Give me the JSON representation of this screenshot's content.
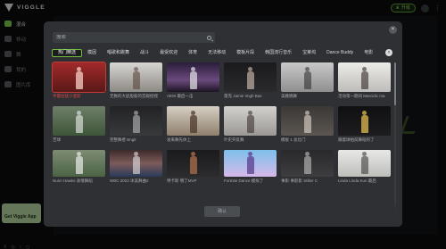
{
  "app": {
    "brand": "VIGGLE"
  },
  "topbar": {
    "upgrade_label": "升级",
    "icons": [
      "crown-icon",
      "avatar",
      "menu-icon"
    ]
  },
  "sidebar": {
    "items": [
      {
        "label": "混合",
        "icon": "mix-icon",
        "active": true
      },
      {
        "label": "移动",
        "icon": "move-icon",
        "active": false
      },
      {
        "label": "舞",
        "icon": "dance-icon",
        "active": false
      },
      {
        "label": "我的",
        "icon": "user-icon",
        "active": false
      },
      {
        "label": "图片库",
        "icon": "library-icon",
        "active": false
      }
    ],
    "get_app": "Get Viggle App",
    "socials": [
      "X",
      "Discord",
      "TikTok",
      "Instagram"
    ]
  },
  "modal": {
    "search_placeholder": "搜索",
    "tabs": [
      {
        "label": "热门精选",
        "active": true
      },
      {
        "label": "模因",
        "active": false
      },
      {
        "label": "唱歌和跳舞",
        "active": false
      },
      {
        "label": "战斗",
        "active": false
      },
      {
        "label": "最受欢迎",
        "active": false
      },
      {
        "label": "体育",
        "active": false
      },
      {
        "label": "无法移动",
        "active": false
      },
      {
        "label": "模板片段",
        "active": false
      },
      {
        "label": "韩国流行音乐",
        "active": false
      },
      {
        "label": "宝莱坞",
        "active": false
      },
      {
        "label": "Dance Buddy",
        "active": false
      },
      {
        "label": "电影",
        "active": false
      }
    ],
    "items": [
      {
        "caption": "手握拉链小混剪",
        "palette": "red",
        "selected": true
      },
      {
        "caption": "无数的大屁股般的宫殿招摇",
        "palette": "light"
      },
      {
        "caption": "AEW 最后一击",
        "palette": "arena"
      },
      {
        "caption": "雷克 Jamie Imgh Bas",
        "palette": "dark"
      },
      {
        "caption": "美腰跳舞",
        "palette": "gray"
      },
      {
        "caption": "活动第一期间 Marcidic ma",
        "palette": "light2"
      },
      {
        "caption": "苦球",
        "palette": "field"
      },
      {
        "caption": "完整舞者 Bngit",
        "palette": "dark2"
      },
      {
        "caption": "发来舞先体上",
        "palette": "room"
      },
      {
        "caption": "叶史开反舞",
        "palette": "gray2"
      },
      {
        "caption": "模板 1 总比门",
        "palette": "hall"
      },
      {
        "caption": "跟着球拍前舞蹈的了",
        "palette": "court"
      },
      {
        "caption": "Nunn Hawks 表情舞蹈",
        "palette": "field2"
      },
      {
        "caption": "WBC 2023 冰美舞曲2",
        "palette": "stadium"
      },
      {
        "caption": "特卡斯 哦了MVP",
        "palette": "person"
      },
      {
        "caption": "Fortnite Dance 模拟了",
        "palette": "game"
      },
      {
        "caption": "事影·事影影 Stiller C",
        "palette": "dark3"
      },
      {
        "caption": "Linda Linda Kun 最后",
        "palette": "light3"
      }
    ],
    "confirm_label": "确认"
  }
}
